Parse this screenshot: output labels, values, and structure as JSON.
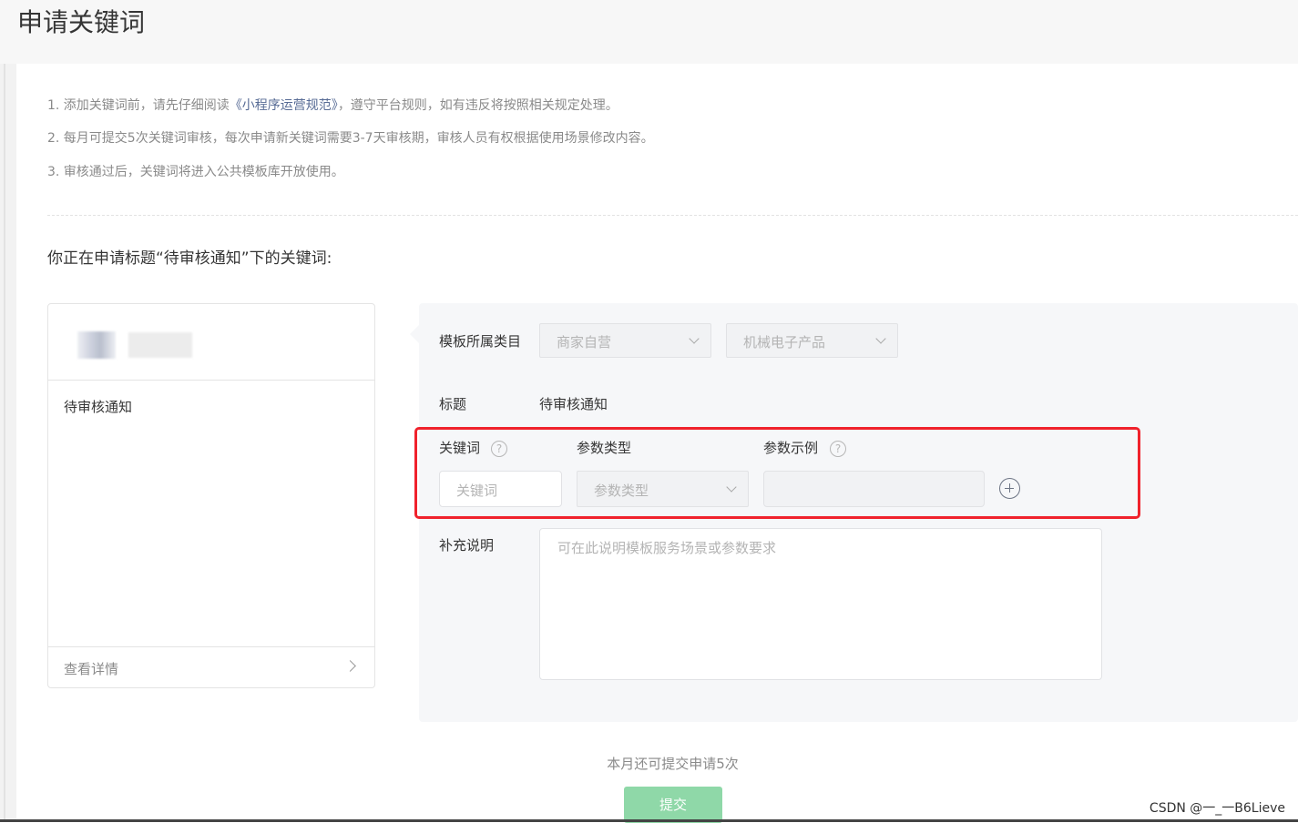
{
  "page": {
    "title": "申请关键词"
  },
  "notices": [
    {
      "before": "1. 添加关键词前，请先仔细阅读",
      "link": "《小程序运营规范》",
      "after": "，遵守平台规则，如有违反将按照相关规定处理。"
    },
    {
      "text": "2. 每月可提交5次关键词审核，每次申请新关键词需要3-7天审核期，审核人员有权根据使用场景修改内容。"
    },
    {
      "text": "3. 审核通过后，关键词将进入公共模板库开放使用。"
    }
  ],
  "subtitle": "你正在申请标题“待审核通知”下的关键词:",
  "preview": {
    "title": "待审核通知",
    "detail_link": "查看详情"
  },
  "form": {
    "category_label": "模板所属类目",
    "category_primary": "商家自营",
    "category_secondary": "机械电子产品",
    "title_label": "标题",
    "title_value": "待审核通知",
    "keyword_label": "关键词",
    "param_type_label": "参数类型",
    "param_example_label": "参数示例",
    "keyword_placeholder": "关键词",
    "param_type_placeholder": "参数类型",
    "param_example_placeholder": "",
    "help_glyph": "?",
    "supplement_label": "补充说明",
    "supplement_placeholder": "可在此说明模板服务场景或参数要求"
  },
  "footer": {
    "remaining_text": "本月还可提交申请5次",
    "submit_label": "提交",
    "watermark": "CSDN @一_一B6Lieve"
  },
  "colors": {
    "link": "#576b95",
    "submit": "#8fd8a8",
    "highlight_box": "#f0222c"
  }
}
